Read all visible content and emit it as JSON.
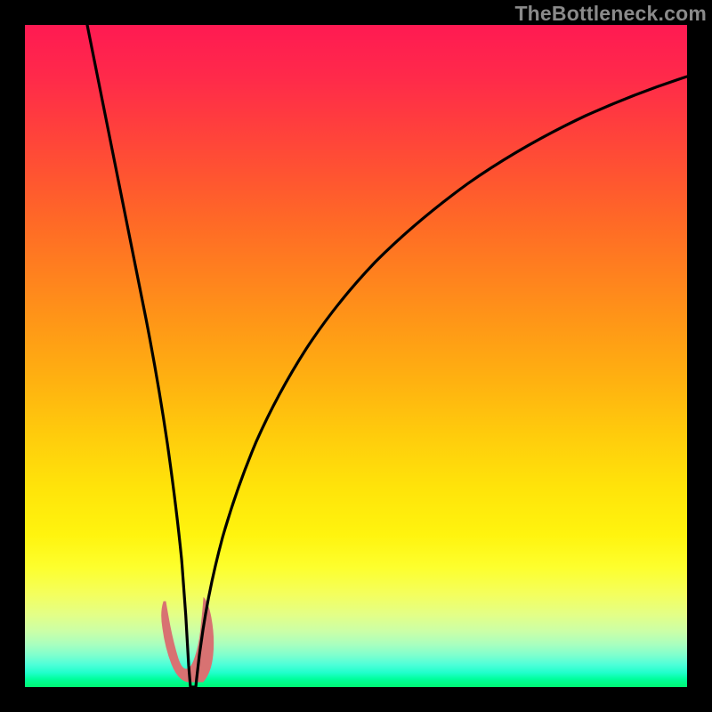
{
  "watermark": "TheBottleneck.com",
  "colors": {
    "frame": "#000000",
    "curve": "#000000",
    "blob": "#d87272",
    "gradient_top": "#ff1a52",
    "gradient_bottom": "#00f774"
  },
  "chart_data": {
    "type": "line",
    "title": "",
    "xlabel": "",
    "ylabel": "",
    "xlim": [
      0,
      100
    ],
    "ylim": [
      0,
      100
    ],
    "notch_x": 24,
    "series": [
      {
        "name": "left-branch",
        "x": [
          10,
          12,
          14,
          16,
          18,
          20,
          21,
          22,
          23,
          23.6,
          24
        ],
        "y": [
          100,
          82,
          66,
          52,
          38,
          24,
          17,
          11,
          6,
          2.5,
          0
        ]
      },
      {
        "name": "right-branch",
        "x": [
          24,
          24.8,
          26,
          28,
          31,
          35,
          40,
          46,
          53,
          61,
          70,
          80,
          90,
          100
        ],
        "y": [
          0,
          3,
          9,
          18,
          29,
          40,
          50,
          58,
          65,
          71,
          76,
          80.5,
          84,
          87
        ]
      }
    ],
    "blob": {
      "name": "bottleneck-marker",
      "points": [
        [
          21.2,
          9.5
        ],
        [
          22.4,
          4.0
        ],
        [
          23.6,
          1.0
        ],
        [
          25.2,
          1.0
        ],
        [
          26.4,
          3.5
        ],
        [
          27.2,
          8.0
        ],
        [
          27.6,
          11.5
        ]
      ]
    }
  }
}
